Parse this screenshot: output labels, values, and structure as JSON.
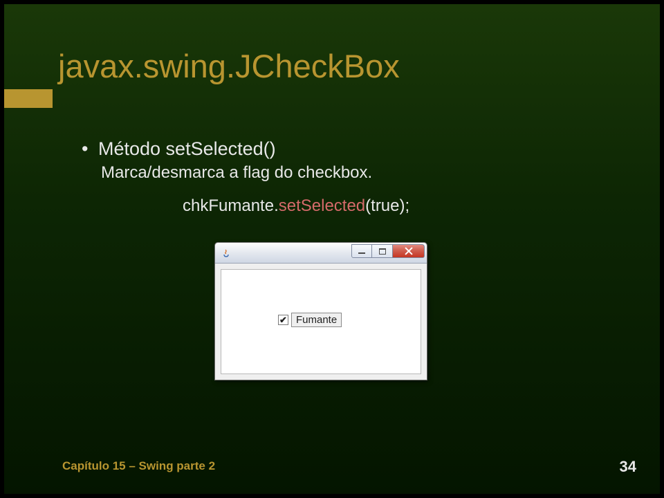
{
  "title": "javax.swing.JCheckBox",
  "bullet": {
    "symbol": "•",
    "text": "Método setSelected()"
  },
  "subtext": "Marca/desmarca a flag do checkbox.",
  "code": {
    "obj": "chkFumante",
    "dot": ".",
    "method": "setSelected",
    "args": "(true);"
  },
  "window": {
    "checkbox_mark": "✔",
    "checkbox_label": "Fumante"
  },
  "footer": {
    "chapter": "Capítulo 15 – Swing parte 2",
    "page": "34"
  }
}
